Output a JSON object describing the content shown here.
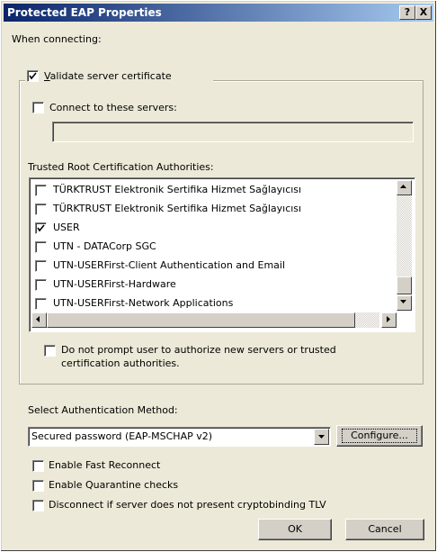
{
  "window": {
    "title": "Protected EAP Properties",
    "help_label": "?",
    "close_label": "X"
  },
  "when_connecting_label": "When connecting:",
  "validate_cert": {
    "label": "Validate server certificate",
    "checked": true
  },
  "connect_servers": {
    "label": "Connect to these servers:",
    "checked": false,
    "value": ""
  },
  "trusted_root_label": "Trusted Root Certification Authorities:",
  "ca_list": [
    {
      "label": "TÜRKTRUST Elektronik Sertifika Hizmet Sağlayıcısı",
      "checked": false
    },
    {
      "label": "TÜRKTRUST Elektronik Sertifika Hizmet Sağlayıcısı",
      "checked": false
    },
    {
      "label": "USER",
      "checked": true
    },
    {
      "label": "UTN - DATACorp SGC",
      "checked": false
    },
    {
      "label": "UTN-USERFirst-Client Authentication and Email",
      "checked": false
    },
    {
      "label": "UTN-USERFirst-Hardware",
      "checked": false
    },
    {
      "label": "UTN-USERFirst-Network Applications",
      "checked": false
    }
  ],
  "do_not_prompt": {
    "line1": "Do not prompt user to authorize new servers or trusted",
    "line2": "certification authorities.",
    "checked": false
  },
  "auth_method_label": "Select Authentication Method:",
  "auth_method_value": "Secured password (EAP-MSCHAP v2)",
  "configure_label": "Configure...",
  "fast_reconnect_label": "Enable Fast Reconnect",
  "quarantine_label": "Enable Quarantine checks",
  "cryptobinding_label": "Disconnect if server does not present cryptobinding TLV",
  "ok_label": "OK",
  "cancel_label": "Cancel"
}
